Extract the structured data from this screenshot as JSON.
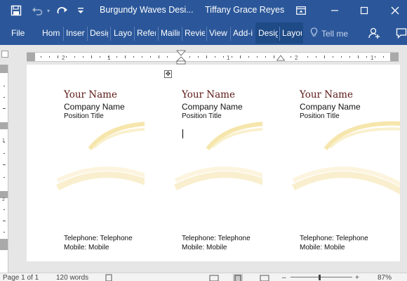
{
  "titlebar": {
    "document_title": "Burgundy Waves Desi...",
    "user_name": "Tiffany Grace Reyes",
    "icons": [
      "save-icon",
      "undo-icon",
      "redo-icon",
      "customize-qat-icon",
      "ribbon-display-icon",
      "minimize-icon",
      "maximize-icon",
      "close-icon"
    ]
  },
  "ribbon": {
    "tabs": [
      "File",
      "Home",
      "Insert",
      "Design",
      "Layout",
      "References",
      "Mailings",
      "Review",
      "View",
      "Add-ins",
      "Design",
      "Layout"
    ],
    "tell_me": "Tell me",
    "icons": [
      "lightbulb-icon",
      "share-icon",
      "comments-icon"
    ]
  },
  "cards": [
    {
      "name": "Your Name",
      "company": "Company Name",
      "position": "Position Title",
      "telephone": "Telephone: Telephone",
      "mobile": "Mobile: Mobile"
    },
    {
      "name": "Your Name",
      "company": "Company Name",
      "position": "Position Title",
      "telephone": "Telephone: Telephone",
      "mobile": "Mobile: Mobile"
    },
    {
      "name": "Your Name",
      "company": "Company Name",
      "position": "Position Title",
      "telephone": "Telephone: Telephone",
      "mobile": "Mobile: Mobile"
    }
  ],
  "statusbar": {
    "page": "Page 1 of 1",
    "words": "120 words",
    "zoom": "87%"
  },
  "colors": {
    "ribbon_blue": "#2b579a",
    "name_burgundy": "#5b1a17",
    "wave_gold": "#f5e3a3"
  }
}
